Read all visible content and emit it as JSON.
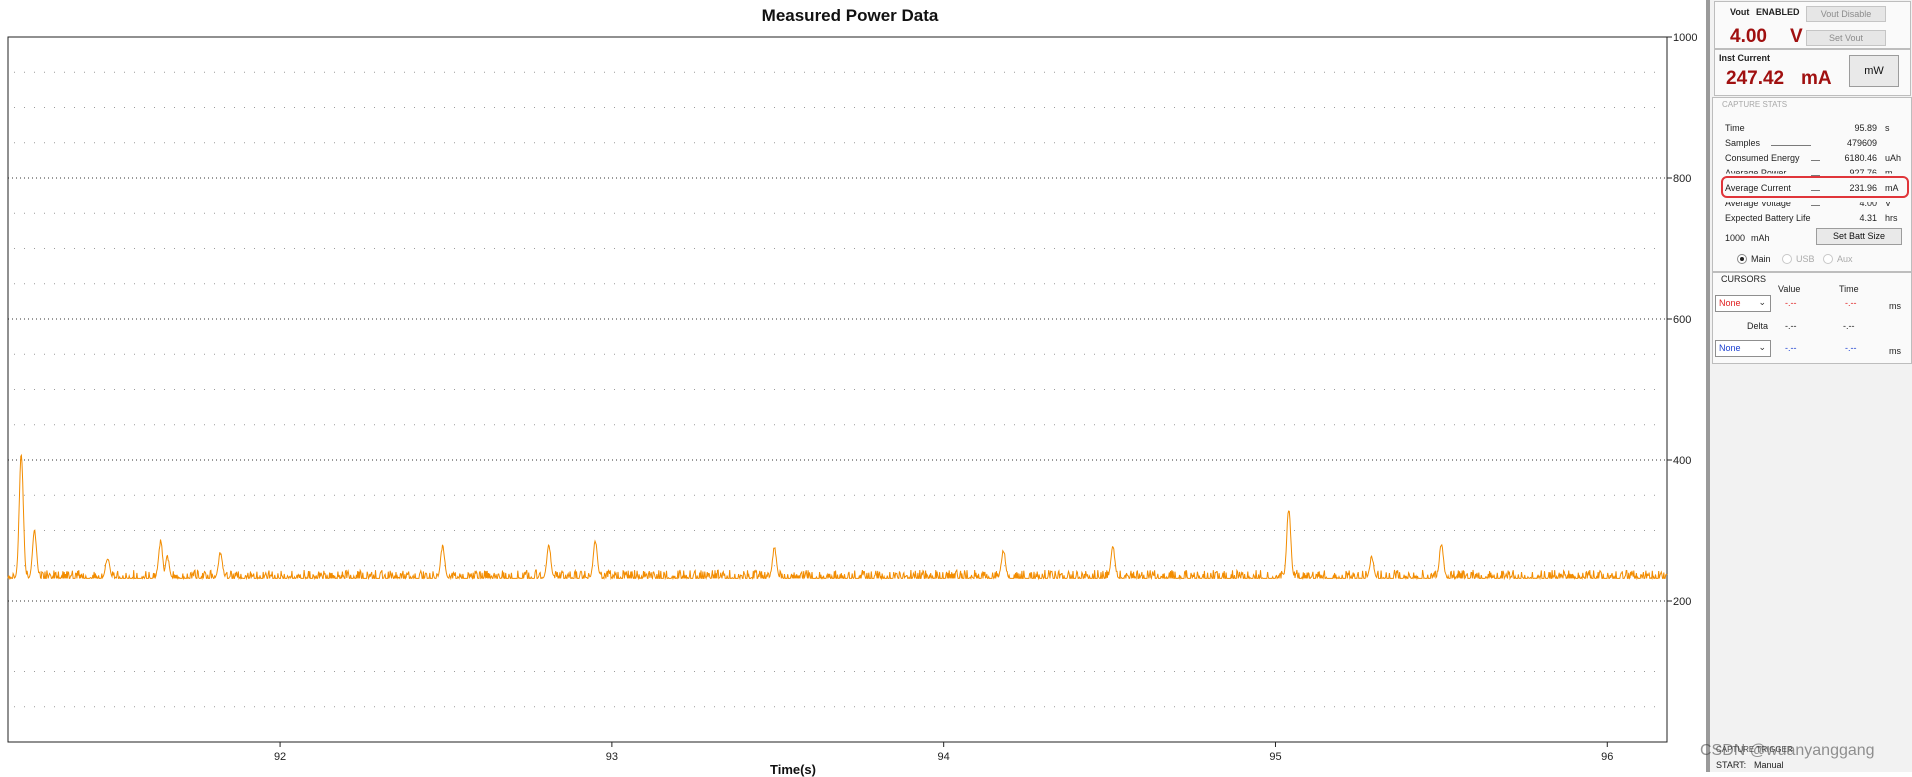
{
  "chart_data": {
    "type": "line",
    "title": "Measured Power Data",
    "xlabel": "Time(s)",
    "ylabel": "",
    "xlim": [
      91.18,
      96.18
    ],
    "ylim": [
      0,
      1000
    ],
    "xticks": [
      92,
      93,
      94,
      95,
      96
    ],
    "xtick_labels": [
      "92",
      "93",
      "94",
      "95",
      "96"
    ],
    "yticks": [
      200,
      400,
      600,
      800,
      1000
    ],
    "ytick_labels": [
      "200",
      "400",
      "600",
      "800",
      "1000"
    ],
    "grid": true,
    "series": [
      {
        "color": "#f28c00",
        "baseline": 232,
        "noise": 12,
        "spikes": [
          {
            "x": 91.22,
            "y": 410
          },
          {
            "x": 91.26,
            "y": 300
          },
          {
            "x": 91.48,
            "y": 262
          },
          {
            "x": 91.64,
            "y": 285
          },
          {
            "x": 91.66,
            "y": 262
          },
          {
            "x": 91.82,
            "y": 268
          },
          {
            "x": 92.49,
            "y": 278
          },
          {
            "x": 92.81,
            "y": 278
          },
          {
            "x": 92.95,
            "y": 285
          },
          {
            "x": 93.49,
            "y": 275
          },
          {
            "x": 94.18,
            "y": 272
          },
          {
            "x": 94.51,
            "y": 276
          },
          {
            "x": 95.04,
            "y": 330
          },
          {
            "x": 95.29,
            "y": 262
          },
          {
            "x": 95.5,
            "y": 280
          }
        ]
      }
    ]
  },
  "vout": {
    "label": "Vout",
    "state": "ENABLED",
    "value": "4.00",
    "unit": "V",
    "disable_button": "Vout Disable",
    "set_button": "Set Vout"
  },
  "inst_current": {
    "label": "Inst Current",
    "value": "247.42",
    "unit": "mA",
    "mw_button": "mW"
  },
  "capture_stats": {
    "title": "CAPTURE STATS",
    "rows": [
      {
        "label": "Time",
        "value": "95.89",
        "unit": "s"
      },
      {
        "label": "Samples",
        "value": "479609",
        "unit": ""
      },
      {
        "label": "Consumed Energy",
        "value": "6180.46",
        "unit": "uAh"
      },
      {
        "label": "Average Power",
        "value": "927.76",
        "unit": "m"
      },
      {
        "label": "Average Current",
        "value": "231.96",
        "unit": "mA"
      },
      {
        "label": "Average Voltage",
        "value": "4.00",
        "unit": "V"
      },
      {
        "label": "Expected Battery Life",
        "value": "4.31",
        "unit": "hrs"
      }
    ],
    "batt_size": "1000",
    "batt_unit": "mAh",
    "set_batt_button": "Set Batt Size",
    "sources": [
      {
        "label": "Main",
        "selected": true
      },
      {
        "label": "USB",
        "selected": false
      },
      {
        "label": "Aux",
        "selected": false
      }
    ]
  },
  "cursors": {
    "title": "CURSORS",
    "col_value": "Value",
    "col_time": "Time",
    "cursor1": {
      "select": "None",
      "value": "-.--",
      "time": "-.--",
      "unit": "ms",
      "color": "#e02020"
    },
    "delta": {
      "label": "Delta",
      "value": "-.--",
      "time": "-.--"
    },
    "cursor2": {
      "select": "None",
      "value": "-.--",
      "time": "-.--",
      "unit": "ms",
      "color": "#1a3fd0"
    }
  },
  "status": {
    "trigger": "CAPTURE TRIGGER",
    "start_label": "START:",
    "start_value": "Manual"
  },
  "watermark": "CSDN @wuanyanggang"
}
